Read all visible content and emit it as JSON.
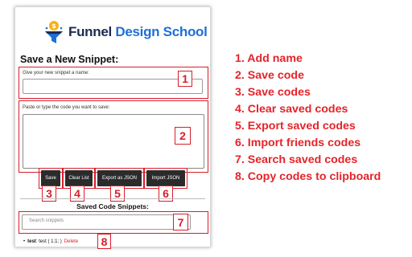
{
  "brand": {
    "name_part1": "Funnel",
    "name_part2": "Design School"
  },
  "form": {
    "heading": "Save a New Snippet:",
    "name_label": "Give your new snippet a name:",
    "name_value": "",
    "code_label": "Paste or type the code you want to save:",
    "code_value": ""
  },
  "buttons": {
    "save": "Save",
    "clear": "Clear List",
    "export": "Export as JSON",
    "import": "Import JSON"
  },
  "saved": {
    "heading": "Saved Code Snippets:",
    "search_placeholder": "Search snippets",
    "items": [
      {
        "name": "test",
        "code": ": test ( 1;1; )",
        "delete_label": "Delete"
      }
    ]
  },
  "callouts": [
    "1",
    "2",
    "3",
    "4",
    "5",
    "6",
    "7",
    "8"
  ],
  "features": [
    "1. Add name",
    "2. Save code",
    "3. Save codes",
    "4. Clear saved codes",
    "5. Export saved codes",
    "6. Import friends codes",
    "7. Search saved codes",
    "8. Copy codes to clipboard"
  ],
  "colors": {
    "annotation_red": "#d81e2b",
    "button_dark": "#2b2b2b",
    "brand_navy": "#1d2b4f",
    "brand_blue": "#1f6fd6",
    "logo_gold": "#f5b21c"
  },
  "icons": {
    "logo": "funnel-dollar-icon"
  }
}
